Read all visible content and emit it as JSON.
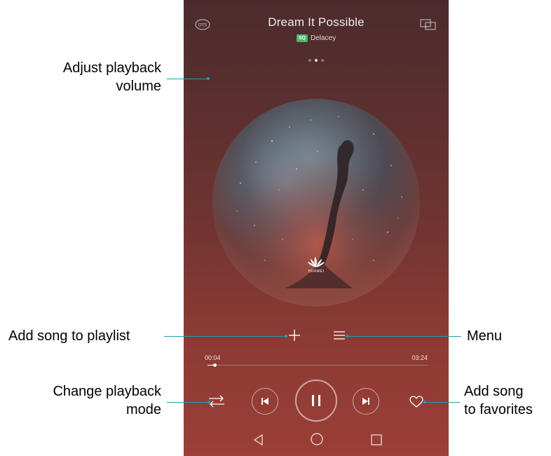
{
  "player": {
    "title": "Dream It Possible",
    "quality_badge": "SQ",
    "artist": "Delacey",
    "brand": "HUAWEI",
    "time_elapsed": "00:04",
    "time_total": "03:24",
    "progress_fraction": 0.033,
    "page_dots": 3,
    "active_page": 1,
    "top_left_icon": "dts-sound-icon",
    "top_right_icon": "screen-cast-icon"
  },
  "controls": {
    "add_to_playlist_icon": "plus-icon",
    "menu_icon": "hamburger-icon",
    "play_mode_icon": "repeat-shuffle-icon",
    "previous_icon": "skip-previous-icon",
    "pause_icon": "pause-icon",
    "next_icon": "skip-next-icon",
    "favorite_icon": "heart-icon"
  },
  "navbar": {
    "back_icon": "triangle-back-icon",
    "home_icon": "circle-home-icon",
    "recents_icon": "square-recents-icon"
  },
  "annotations": {
    "volume": [
      "Adjust playback",
      "volume"
    ],
    "add_to_playlist": "Add song to playlist",
    "menu": "Menu",
    "play_mode": [
      "Change playback",
      "mode"
    ],
    "favorites": [
      "Add song",
      "to favorites"
    ]
  },
  "colors": {
    "annotation_line": "#1e9fb0",
    "sq_badge": "#43b96a"
  }
}
